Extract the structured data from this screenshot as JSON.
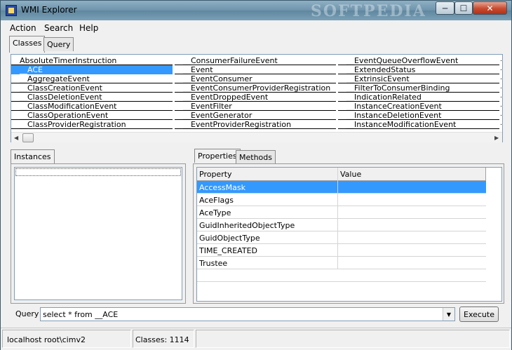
{
  "window": {
    "title": "WMI Explorer",
    "watermark": "SOFTPEDIA"
  },
  "controls": {
    "minimize": "─",
    "maximize": "☐",
    "close": "✕"
  },
  "menu": [
    "Action",
    "Search",
    "Help"
  ],
  "top_tabs": [
    {
      "label": "Classes",
      "active": true
    },
    {
      "label": "Query",
      "active": false
    }
  ],
  "classes": {
    "columns": [
      [
        "AbsoluteTimerInstruction",
        "__ACE",
        "__AggregateEvent",
        "__ClassCreationEvent",
        "__ClassDeletionEvent",
        "__ClassModificationEvent",
        "__ClassOperationEvent",
        "__ClassProviderRegistration"
      ],
      [
        "__ConsumerFailureEvent",
        "__Event",
        "__EventConsumer",
        "__EventConsumerProviderRegistration",
        "__EventDroppedEvent",
        "__EventFilter",
        "__EventGenerator",
        "__EventProviderRegistration"
      ],
      [
        "__EventQueueOverflowEvent",
        "__ExtendedStatus",
        "__ExtrinsicEvent",
        "__FilterToConsumerBinding",
        "__IndicationRelated",
        "__InstanceCreationEvent",
        "__InstanceDeletionEvent",
        "__InstanceModificationEvent"
      ]
    ],
    "selected": "__ACE"
  },
  "instances_tab": "Instances",
  "detail_tabs": [
    {
      "label": "Properties",
      "active": true
    },
    {
      "label": "Methods",
      "active": false
    }
  ],
  "properties": {
    "headers": [
      "Property",
      "Value"
    ],
    "rows": [
      "AccessMask",
      "AceFlags",
      "AceType",
      "GuidInheritedObjectType",
      "GuidObjectType",
      "TIME_CREATED",
      "Trustee"
    ],
    "selected": "AccessMask"
  },
  "query": {
    "label": "Query",
    "value": "select * from __ACE",
    "execute_label": "Execute"
  },
  "status": {
    "connection": "localhost  root\\cimv2",
    "classes": "Classes: 1114"
  },
  "icons": {
    "app": "wmi-app-icon",
    "dropdown": "chevron-down-icon",
    "scroll_left": "arrow-left-icon",
    "scroll_right": "arrow-right-icon"
  }
}
